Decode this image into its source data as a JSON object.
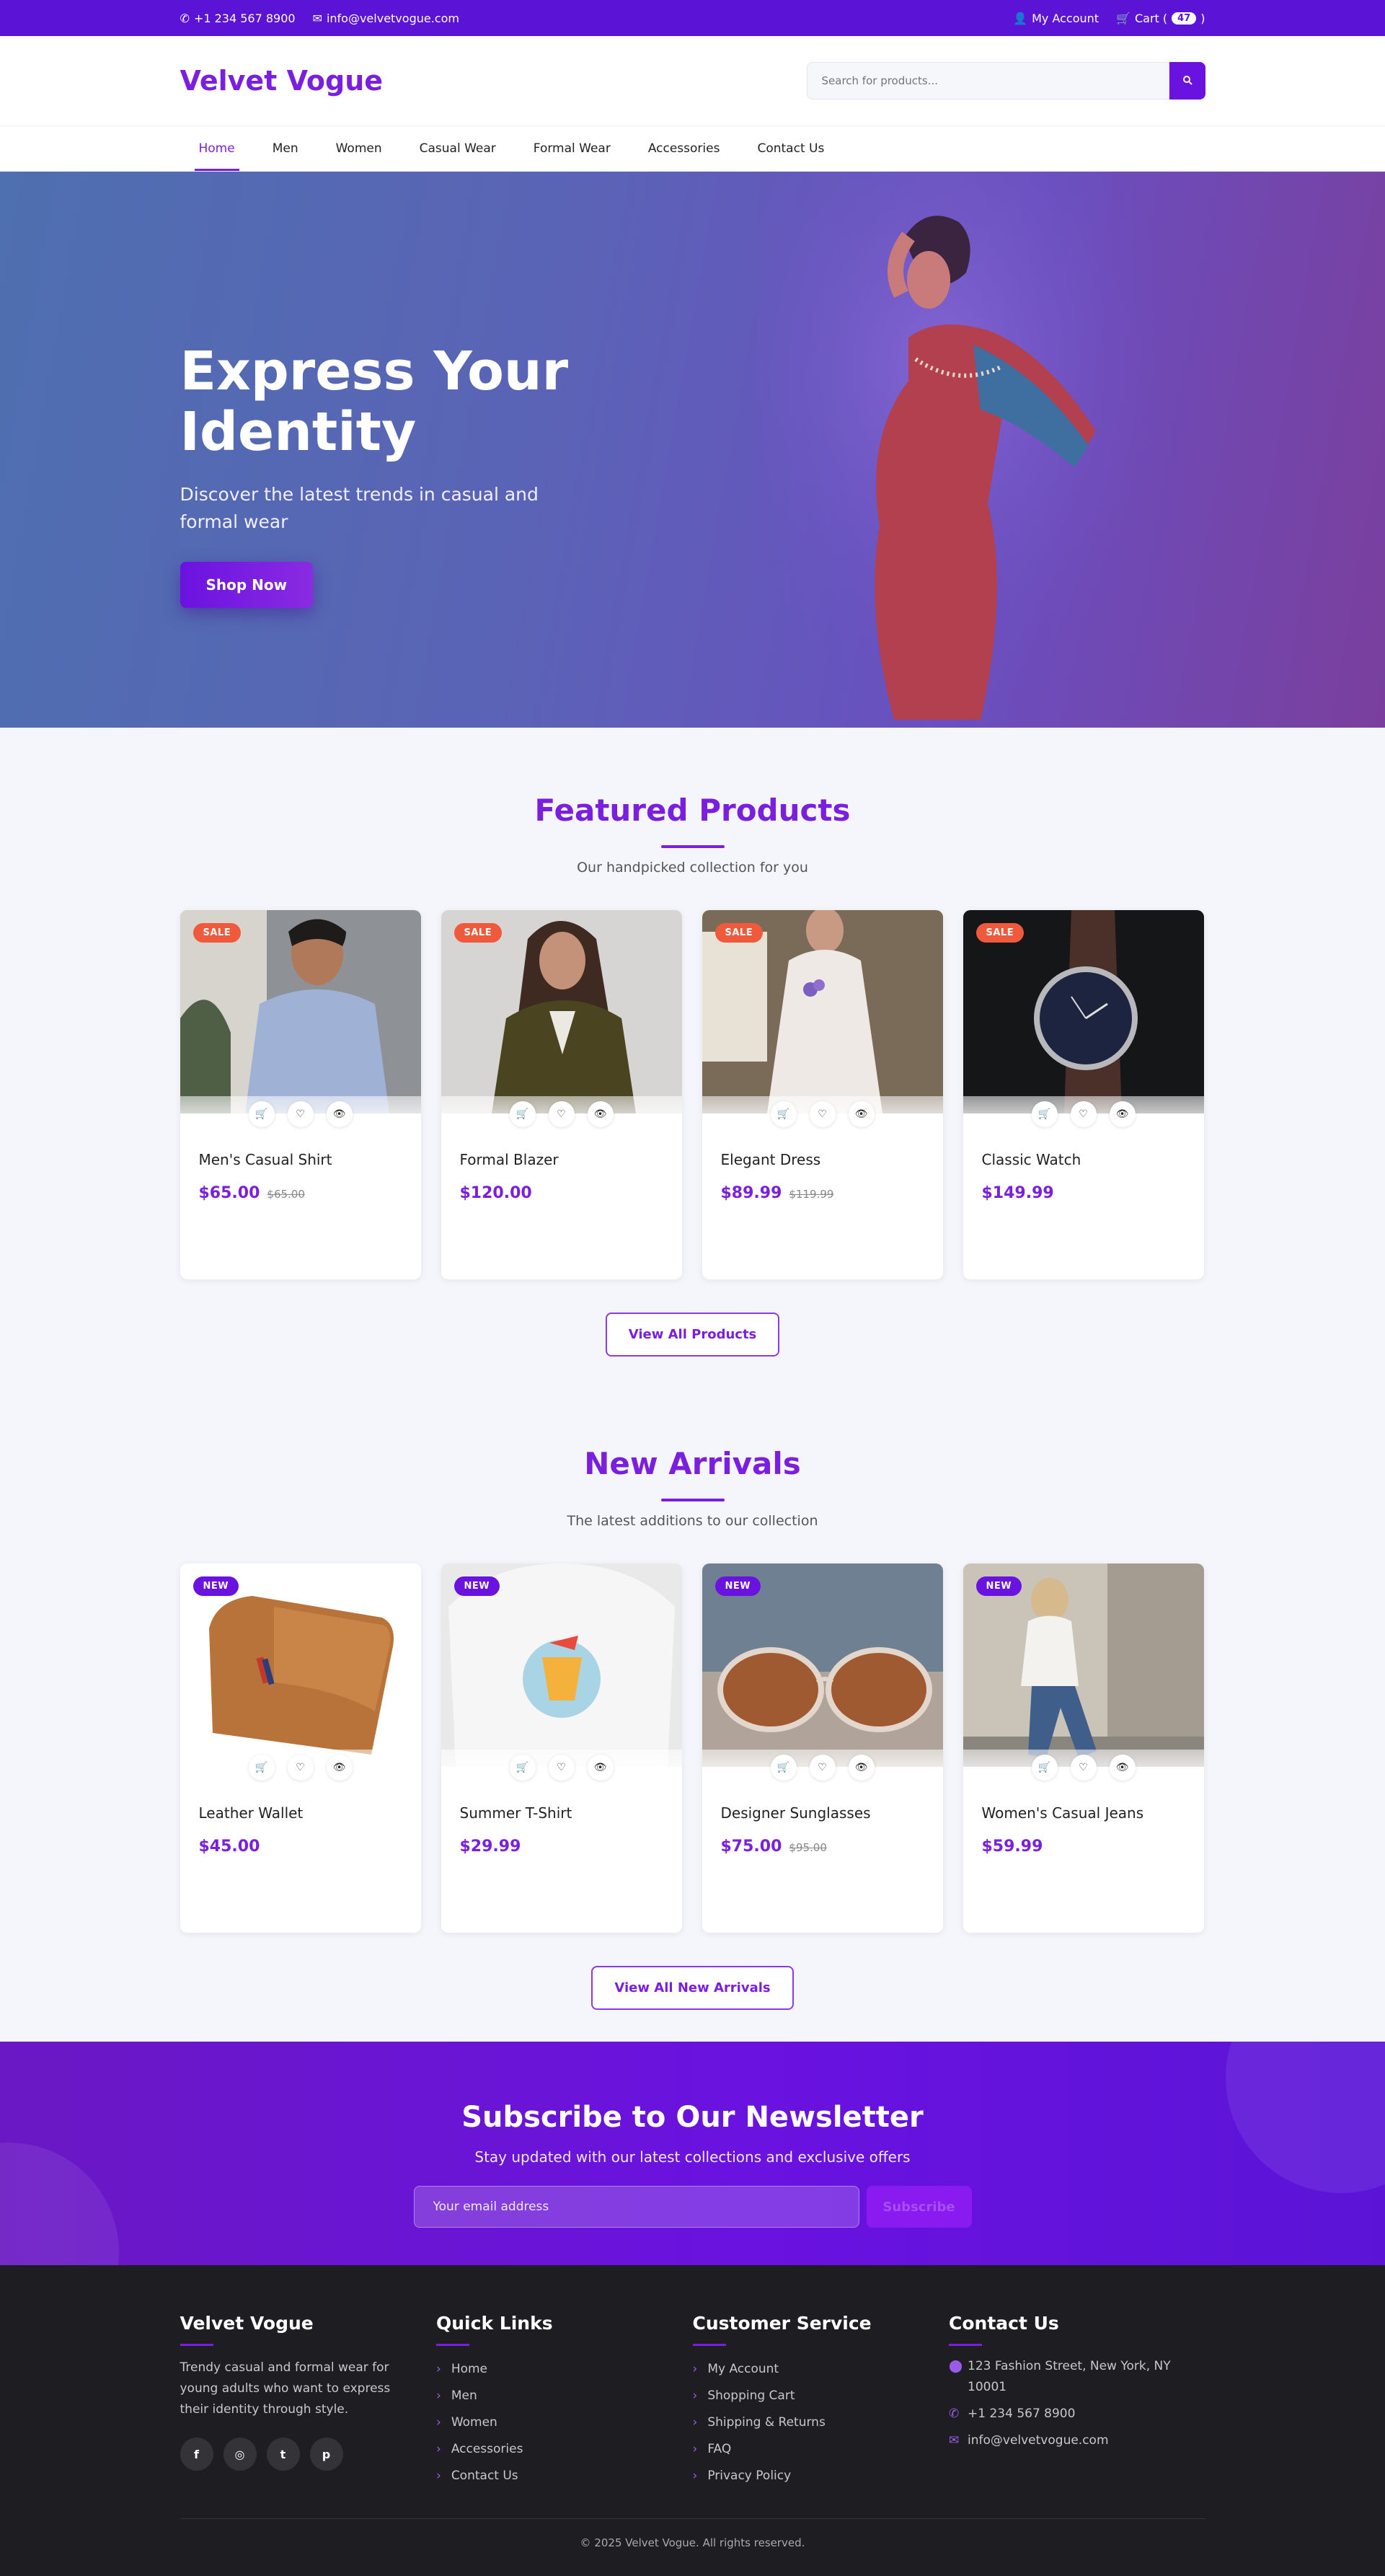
{
  "topbar": {
    "phone": "+1 234 567 8900",
    "email": "info@velvetvogue.com",
    "account": "My Account",
    "cart_label": "Cart (",
    "cart_count": "47",
    "cart_close": ")"
  },
  "header": {
    "logo": "Velvet Vogue",
    "search_placeholder": "Search for products..."
  },
  "nav": {
    "items": [
      "Home",
      "Men",
      "Women",
      "Casual Wear",
      "Formal Wear",
      "Accessories",
      "Contact Us"
    ],
    "active": "Home"
  },
  "hero": {
    "title_line1": "Express Your",
    "title_line2": "Identity",
    "subtitle": "Discover the latest trends in casual and formal wear",
    "cta": "Shop Now"
  },
  "featured": {
    "title": "Featured Products",
    "subtitle": "Our handpicked collection for you",
    "button": "View All Products",
    "products": [
      {
        "name": "Men's Casual Shirt",
        "price": "$65.00",
        "old_price": "$65.00",
        "badge": "SALE"
      },
      {
        "name": "Formal Blazer",
        "price": "$120.00",
        "old_price": "",
        "badge": "SALE"
      },
      {
        "name": "Elegant Dress",
        "price": "$89.99",
        "old_price": "$119.99",
        "badge": "SALE"
      },
      {
        "name": "Classic Watch",
        "price": "$149.99",
        "old_price": "",
        "badge": "SALE"
      }
    ]
  },
  "arrivals": {
    "title": "New Arrivals",
    "subtitle": "The latest additions to our collection",
    "button": "View All New Arrivals",
    "products": [
      {
        "name": "Leather Wallet",
        "price": "$45.00",
        "old_price": "",
        "badge": "NEW"
      },
      {
        "name": "Summer T-Shirt",
        "price": "$29.99",
        "old_price": "",
        "badge": "NEW"
      },
      {
        "name": "Designer Sunglasses",
        "price": "$75.00",
        "old_price": "$95.00",
        "badge": "NEW"
      },
      {
        "name": "Women's Casual Jeans",
        "price": "$59.99",
        "old_price": "",
        "badge": "NEW"
      }
    ]
  },
  "newsletter": {
    "title": "Subscribe to Our Newsletter",
    "subtitle": "Stay updated with our latest collections and exclusive offers",
    "placeholder": "Your email address",
    "button": "Subscribe"
  },
  "footer": {
    "brand": "Velvet Vogue",
    "description": "Trendy casual and formal wear for young adults who want to express their identity through style.",
    "socials": [
      "f",
      "◎",
      "t",
      "p"
    ],
    "quick_links_title": "Quick Links",
    "quick_links": [
      "Home",
      "Men",
      "Women",
      "Accessories",
      "Contact Us"
    ],
    "service_title": "Customer Service",
    "service_links": [
      "My Account",
      "Shopping Cart",
      "Shipping & Returns",
      "FAQ",
      "Privacy Policy"
    ],
    "contact_title": "Contact Us",
    "address": "123 Fashion Street, New York, NY 10001",
    "phone": "+1 234 567 8900",
    "email": "info@velvetvogue.com",
    "copyright": "© 2025 Velvet Vogue. All rights reserved."
  },
  "colors": {
    "brand": "#7a1ee0",
    "topbar": "#5b14d6",
    "sale": "#ef5a3c",
    "footer": "#1e1e22"
  }
}
